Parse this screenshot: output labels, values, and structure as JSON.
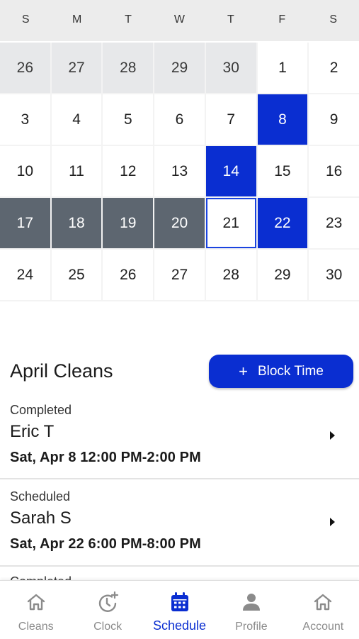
{
  "calendar": {
    "weekdays": [
      "S",
      "M",
      "T",
      "W",
      "T",
      "F",
      "S"
    ],
    "days": [
      {
        "label": "26",
        "state": "other"
      },
      {
        "label": "27",
        "state": "other"
      },
      {
        "label": "28",
        "state": "other"
      },
      {
        "label": "29",
        "state": "other"
      },
      {
        "label": "30",
        "state": "other"
      },
      {
        "label": "1",
        "state": "normal"
      },
      {
        "label": "2",
        "state": "normal"
      },
      {
        "label": "3",
        "state": "normal"
      },
      {
        "label": "4",
        "state": "normal"
      },
      {
        "label": "5",
        "state": "normal"
      },
      {
        "label": "6",
        "state": "normal"
      },
      {
        "label": "7",
        "state": "normal"
      },
      {
        "label": "8",
        "state": "selected"
      },
      {
        "label": "9",
        "state": "normal"
      },
      {
        "label": "10",
        "state": "normal"
      },
      {
        "label": "11",
        "state": "normal"
      },
      {
        "label": "12",
        "state": "normal"
      },
      {
        "label": "13",
        "state": "normal"
      },
      {
        "label": "14",
        "state": "selected"
      },
      {
        "label": "15",
        "state": "normal"
      },
      {
        "label": "16",
        "state": "normal"
      },
      {
        "label": "17",
        "state": "blocked"
      },
      {
        "label": "18",
        "state": "blocked"
      },
      {
        "label": "19",
        "state": "blocked"
      },
      {
        "label": "20",
        "state": "blocked"
      },
      {
        "label": "21",
        "state": "today"
      },
      {
        "label": "22",
        "state": "selected"
      },
      {
        "label": "23",
        "state": "normal"
      },
      {
        "label": "24",
        "state": "normal"
      },
      {
        "label": "25",
        "state": "normal"
      },
      {
        "label": "26",
        "state": "normal"
      },
      {
        "label": "27",
        "state": "normal"
      },
      {
        "label": "28",
        "state": "normal"
      },
      {
        "label": "29",
        "state": "normal"
      },
      {
        "label": "30",
        "state": "normal"
      }
    ]
  },
  "cleans": {
    "title": "April Cleans",
    "block_button": {
      "icon": "+",
      "label": "Block Time"
    },
    "items": [
      {
        "status": "Completed",
        "name": "Eric T",
        "when": "Sat, Apr 8  12:00 PM-2:00 PM"
      },
      {
        "status": "Scheduled",
        "name": "Sarah S",
        "when": "Sat, Apr 22  6:00 PM-8:00 PM"
      }
    ],
    "peek_status": "Completed"
  },
  "tabs": [
    {
      "label": "Cleans",
      "icon": "home-icon",
      "active": false
    },
    {
      "label": "Clock",
      "icon": "clock-add-icon",
      "active": false
    },
    {
      "label": "Schedule",
      "icon": "calendar-icon",
      "active": true
    },
    {
      "label": "Profile",
      "icon": "person-icon",
      "active": false
    },
    {
      "label": "Account",
      "icon": "home-icon",
      "active": false
    }
  ],
  "colors": {
    "accent": "#0a2ed1",
    "blocked": "#5d6670",
    "other_month": "#e7e8ea"
  }
}
